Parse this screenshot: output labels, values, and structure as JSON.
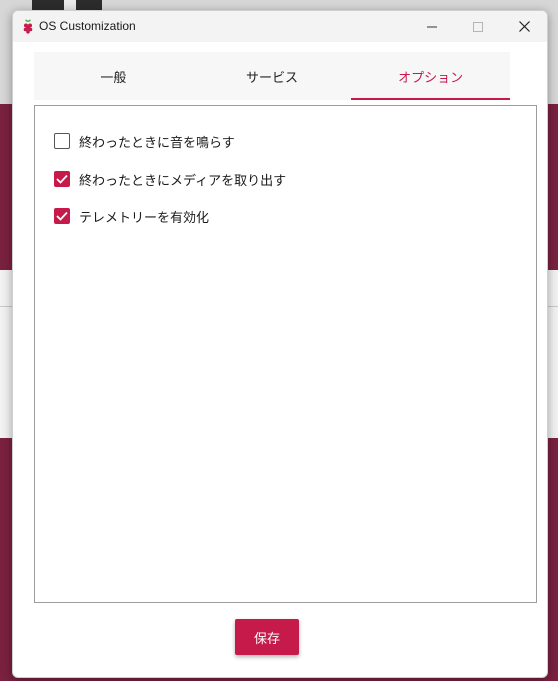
{
  "window": {
    "title": "OS Customization",
    "icon": "raspberry-icon",
    "controls": [
      "minimize-icon",
      "maximize-icon",
      "close-icon"
    ]
  },
  "tabs": [
    {
      "label": "一般",
      "active": false
    },
    {
      "label": "サービス",
      "active": false
    },
    {
      "label": "オプション",
      "active": true
    }
  ],
  "options": [
    {
      "label": "終わったときに音を鳴らす",
      "checked": false
    },
    {
      "label": "終わったときにメディアを取り出す",
      "checked": true
    },
    {
      "label": "テレメトリーを有効化",
      "checked": true
    }
  ],
  "footer": {
    "save_label": "保存"
  },
  "colors": {
    "accent": "#c51a4a",
    "background_app": "#7a2140"
  }
}
